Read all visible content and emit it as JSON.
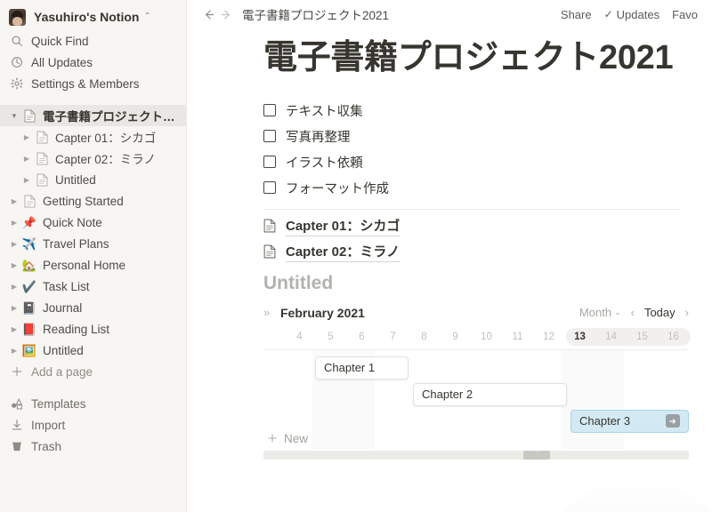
{
  "sidebar": {
    "workspace": {
      "name": "Yasuhiro's Notion",
      "caret_icon": "chevron-updown-icon"
    },
    "nav": [
      {
        "label": "Quick Find",
        "icon": "search-icon"
      },
      {
        "label": "All Updates",
        "icon": "clock-icon"
      },
      {
        "label": "Settings & Members",
        "icon": "gear-icon"
      }
    ],
    "tree": [
      {
        "label": "電子書籍プロジェクト2...",
        "icon": "page-icon",
        "expanded": true,
        "selected": true,
        "depth": 0
      },
      {
        "label": "Capter 01：シカゴ",
        "icon": "page-icon",
        "expanded": false,
        "selected": false,
        "depth": 1
      },
      {
        "label": "Capter 02：ミラノ",
        "icon": "page-icon",
        "expanded": false,
        "selected": false,
        "depth": 1
      },
      {
        "label": "Untitled",
        "icon": "page-icon",
        "expanded": false,
        "selected": false,
        "depth": 1
      },
      {
        "label": "Getting Started",
        "icon": "page-icon",
        "expanded": false,
        "selected": false,
        "depth": 0
      },
      {
        "label": "Quick Note",
        "icon": "pushpin-emoji",
        "emoji": "📌",
        "expanded": false,
        "selected": false,
        "depth": 0
      },
      {
        "label": "Travel Plans",
        "icon": "airplane-emoji",
        "emoji": "✈️",
        "expanded": false,
        "selected": false,
        "depth": 0
      },
      {
        "label": "Personal Home",
        "icon": "house-emoji",
        "emoji": "🏡",
        "expanded": false,
        "selected": false,
        "depth": 0
      },
      {
        "label": "Task List",
        "icon": "checkmark-emoji",
        "emoji": "✔️",
        "expanded": false,
        "selected": false,
        "depth": 0
      },
      {
        "label": "Journal",
        "icon": "notebook-emoji",
        "emoji": "📓",
        "expanded": false,
        "selected": false,
        "depth": 0
      },
      {
        "label": "Reading List",
        "icon": "closed-book-emoji",
        "emoji": "📕",
        "expanded": false,
        "selected": false,
        "depth": 0
      },
      {
        "label": "Untitled",
        "icon": "picture-emoji",
        "emoji": "🖼️",
        "expanded": false,
        "selected": false,
        "depth": 0
      }
    ],
    "add_page": {
      "label": "Add a page",
      "icon": "plus-icon"
    },
    "footer": [
      {
        "label": "Templates",
        "icon": "templates-icon"
      },
      {
        "label": "Import",
        "icon": "import-icon"
      },
      {
        "label": "Trash",
        "icon": "trash-icon"
      }
    ]
  },
  "topbar": {
    "back_icon": "arrow-left-icon",
    "forward_icon": "arrow-right-icon",
    "breadcrumb": "電子書籍プロジェクト2021",
    "share": "Share",
    "updates": "Updates",
    "favorite": "Favo"
  },
  "page": {
    "title": "電子書籍プロジェクト2021",
    "todos": [
      {
        "text": "テキスト収集",
        "checked": false
      },
      {
        "text": "写真再整理",
        "checked": false
      },
      {
        "text": "イラスト依頼",
        "checked": false
      },
      {
        "text": "フォーマット作成",
        "checked": false
      }
    ],
    "page_links": [
      {
        "text": "Capter 01：シカゴ",
        "icon": "page-icon"
      },
      {
        "text": "Capter 02：ミラノ",
        "icon": "page-icon"
      }
    ],
    "untitled_heading": "Untitled"
  },
  "timeline": {
    "expand_icon": "double-chevron-right-icon",
    "month_label": "February 2021",
    "zoom_select": "Month",
    "zoom_caret_icon": "chevron-down-icon",
    "prev_icon": "chevron-left-icon",
    "today_label": "Today",
    "next_icon": "chevron-right-icon",
    "dates": [
      "4",
      "5",
      "6",
      "7",
      "8",
      "9",
      "10",
      "11",
      "12",
      "13",
      "14",
      "15",
      "16"
    ],
    "today_date": "13",
    "bars": [
      {
        "label": "Chapter 1",
        "selected": false,
        "start_index": 1,
        "span": 3
      },
      {
        "label": "Chapter 2",
        "selected": false,
        "start_index": 4,
        "span": 5
      },
      {
        "label": "Chapter 3",
        "selected": true,
        "start_index": 9,
        "span": 4,
        "open_icon": "open-page-arrow-icon"
      }
    ],
    "new_label": "New",
    "new_icon": "plus-icon",
    "scrollbar": "horizontal-scrollbar"
  },
  "colors": {
    "sidebar_bg": "#f7f6f3",
    "selected_bar": "#d3e9f3",
    "text": "#37352f",
    "muted": "#a9a7a1"
  }
}
